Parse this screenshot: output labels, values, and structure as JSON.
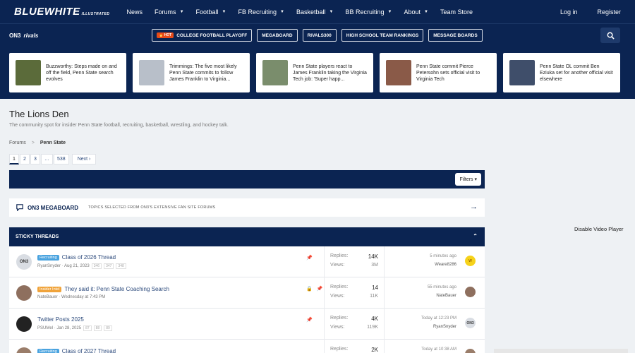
{
  "nav": {
    "logo": "BLUEWHITE",
    "logo_sub": "ILLUSTRATED",
    "items": [
      {
        "label": "News",
        "caret": false
      },
      {
        "label": "Forums",
        "caret": true
      },
      {
        "label": "Football",
        "caret": true
      },
      {
        "label": "FB Recruiting",
        "caret": true
      },
      {
        "label": "Basketball",
        "caret": true
      },
      {
        "label": "BB Recruiting",
        "caret": true
      },
      {
        "label": "About",
        "caret": true
      },
      {
        "label": "Team Store",
        "caret": false
      }
    ],
    "login": "Log in",
    "register": "Register"
  },
  "subbar": {
    "on3": "ON3",
    "rivals": "rivals",
    "hot_badge": "HOT",
    "pills": [
      "COLLEGE FOOTBALL PLAYOFF",
      "MEGABOARD",
      "RIVALS300",
      "HIGH SCHOOL TEAM RANKINGS",
      "MESSAGE BOARDS"
    ]
  },
  "news": [
    {
      "text": "Buzzworthy: Steps made on and off the field, Penn State search evolves",
      "thumb_color": "#5b6b3a"
    },
    {
      "text": "Trimmings: The five most likely Penn State commits to follow James Franklin to Virginia...",
      "thumb_color": "#b8bfc9"
    },
    {
      "text": "Penn State players react to James Franklin taking the Virginia Tech job: 'Super happ...",
      "thumb_color": "#7a8d6c"
    },
    {
      "text": "Penn State commit Pierce Petersohn sets official visit to Virginia Tech",
      "thumb_color": "#8a5a48"
    },
    {
      "text": "Penn State OL commit Ben Eziuka set for another official visit elsewhere",
      "thumb_color": "#3f4e6a"
    }
  ],
  "page": {
    "title": "The Lions Den",
    "description": "The community spot for insider Penn State football, recruiting, basketball, wrestling, and hockey talk."
  },
  "breadcrumb": {
    "root": "Forums",
    "sep": ">",
    "current": "Penn State"
  },
  "pager": {
    "pages": [
      "1",
      "2",
      "3",
      "…",
      "538"
    ],
    "next": "Next ›"
  },
  "filters_label": "Filters ▾",
  "megaboard": {
    "title": "ON3 MEGABOARD",
    "subtitle": "TOPICS SELECTED FROM ON3'S EXTENSIVE FAN SITE FORUMS",
    "arrow": "→"
  },
  "sticky": {
    "title": "STICKY THREADS",
    "collapse": "⌃"
  },
  "threads": [
    {
      "avatar_text": "ON3",
      "avatar_bg": "#d9dde3",
      "avatar_fg": "#333",
      "tag": "Recruiting",
      "tag_bg": "#4aa3df",
      "tag_fg": "#fff",
      "title": "Class of 2026 Thread",
      "author": "RyanSnyder",
      "date": "· Aug 21, 2023",
      "pages": [
        "346",
        "347",
        "348"
      ],
      "icons": [
        "📌"
      ],
      "replies_label": "Replies:",
      "replies": "14K",
      "views_label": "Views:",
      "views": "3M",
      "last_time": "5 minutes ago",
      "last_user": "Weare8286",
      "last_av_text": "W",
      "last_av_bg": "#f6d21a",
      "last_av_fg": "#a06b00"
    },
    {
      "avatar_text": "",
      "avatar_bg": "#8e6f5e",
      "avatar_fg": "#fff",
      "tag": "Insider Intel",
      "tag_bg": "#f0a33a",
      "tag_fg": "#fff",
      "title": "They said it: Penn State Coaching Search",
      "author": "NateBauer",
      "date": "· Wednesday at 7:43 PM",
      "pages": [],
      "icons": [
        "🔒",
        "📌"
      ],
      "replies_label": "Replies:",
      "replies": "14",
      "views_label": "Views:",
      "views": "11K",
      "last_time": "55 minutes ago",
      "last_user": "NateBauer",
      "last_av_text": "",
      "last_av_bg": "#8e6f5e",
      "last_av_fg": "#fff"
    },
    {
      "avatar_text": "",
      "avatar_bg": "#222",
      "avatar_fg": "#fff",
      "tag": "",
      "tag_bg": "",
      "tag_fg": "",
      "title": "Twitter Posts 2025",
      "author": "PSUMel",
      "date": "· Jan 28, 2025",
      "pages": [
        "87",
        "88",
        "89"
      ],
      "icons": [
        "📌"
      ],
      "replies_label": "Replies:",
      "replies": "4K",
      "views_label": "Views:",
      "views": "119K",
      "last_time": "Today at 12:23 PM",
      "last_user": "RyanSnyder",
      "last_av_text": "ON3",
      "last_av_bg": "#d9dde3",
      "last_av_fg": "#333"
    },
    {
      "avatar_text": "",
      "avatar_bg": "#9a7d6a",
      "avatar_fg": "#fff",
      "tag": "Recruiting",
      "tag_bg": "#4aa3df",
      "tag_fg": "#fff",
      "title": "Class of 2027 Thread",
      "author": "",
      "date": "",
      "pages": [],
      "icons": [],
      "replies_label": "Replies:",
      "replies": "2K",
      "views_label": "",
      "views": "",
      "last_time": "Today at 10:38 AM",
      "last_user": "",
      "last_av_text": "",
      "last_av_bg": "#9a7d6a",
      "last_av_fg": "#fff"
    }
  ],
  "sidebar": {
    "disable_video": "Disable Video Player"
  }
}
